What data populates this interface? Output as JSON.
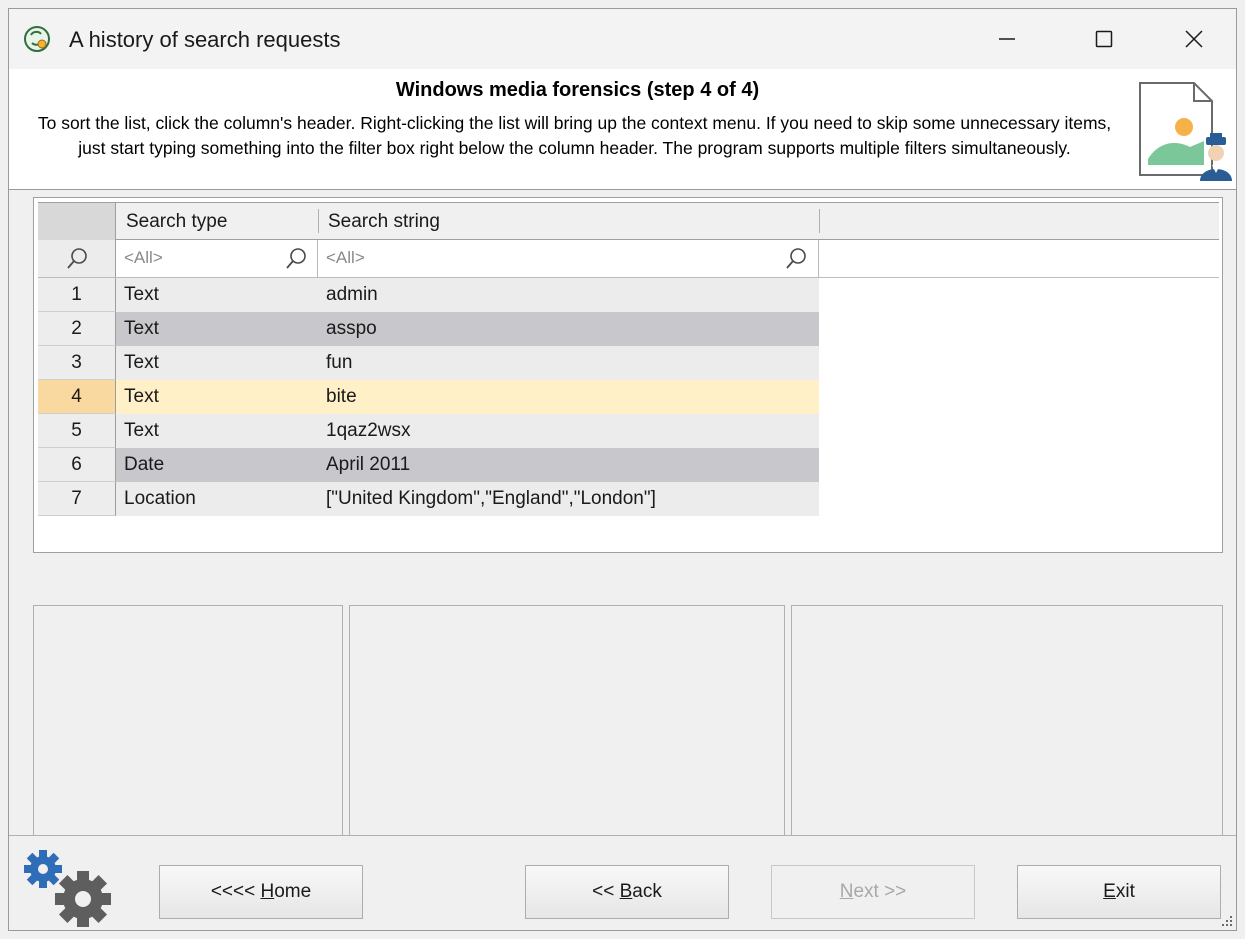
{
  "window": {
    "title": "A history of search requests",
    "controls": [
      "minimize",
      "maximize",
      "close"
    ]
  },
  "header": {
    "title": "Windows media forensics (step 4 of 4)",
    "description": "To sort the list, click the column's header. Right-clicking the list will bring up the context menu. If you need to skip some unnecessary items, just start typing something into the filter box right below the column header. The program supports multiple filters simultaneously.",
    "icon": "image-document-with-police-officer-icon"
  },
  "grid": {
    "columns": [
      "Search type",
      "Search string"
    ],
    "filters": [
      "<All>",
      "<All>"
    ],
    "rows": [
      {
        "num": "1",
        "type": "Text",
        "string": "admin"
      },
      {
        "num": "2",
        "type": "Text",
        "string": "asspo"
      },
      {
        "num": "3",
        "type": "Text",
        "string": "fun"
      },
      {
        "num": "4",
        "type": "Text",
        "string": "bite"
      },
      {
        "num": "5",
        "type": "Text",
        "string": "1qaz2wsx"
      },
      {
        "num": "6",
        "type": "Date",
        "string": "April 2011"
      },
      {
        "num": "7",
        "type": "Location",
        "string": "[\"United Kingdom\",\"England\",\"London\"]"
      }
    ],
    "selected_row": "4",
    "colors": {
      "row_light": "#ececec",
      "row_dark": "#c8c8cc",
      "row_selected": "#fff0c8",
      "rownum_selected": "#fad9a0"
    }
  },
  "buttons": {
    "home": {
      "prefix": "<<<< ",
      "underlined": "H",
      "rest": "ome"
    },
    "back": {
      "prefix": "<< ",
      "underlined": "B",
      "rest": "ack"
    },
    "next": {
      "prefix": "",
      "underlined": "N",
      "rest": "ext >>",
      "enabled": false
    },
    "exit": {
      "prefix": "",
      "underlined": "E",
      "rest": "xit"
    }
  }
}
